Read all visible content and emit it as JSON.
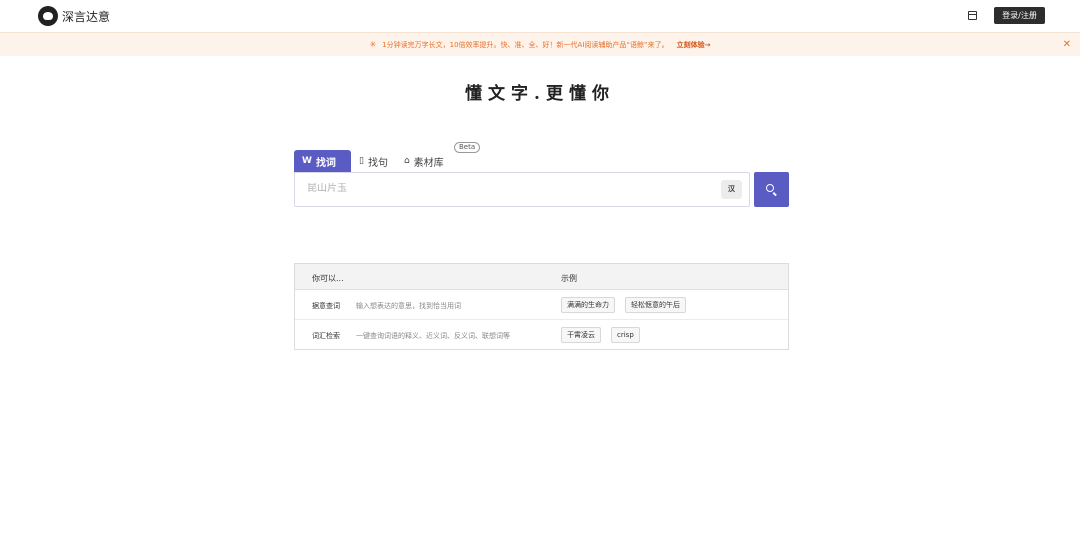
{
  "header": {
    "logo_text": "深言达意",
    "login_label": "登录/注册"
  },
  "banner": {
    "text": "1分钟读完万字长文，10倍效率提升。快、准、全、好！新一代AI阅读辅助产品“语鲸”来了。",
    "link": "立刻体验→",
    "close": "✕"
  },
  "hero": {
    "title": "懂文字.更懂你"
  },
  "tabs": [
    {
      "label": "找词",
      "icon": "W"
    },
    {
      "label": "找句",
      "icon": "▯"
    },
    {
      "label": "素材库",
      "icon": "⌂",
      "badge": "Beta"
    }
  ],
  "search": {
    "placeholder": "昆山片玉",
    "lang_toggle": "汉"
  },
  "guide": {
    "col_task": "你可以...",
    "col_example": "示例",
    "rows": [
      {
        "name": "据意查词",
        "desc": "输入想表达的意思，找到恰当用词",
        "examples": [
          "满满的生命力",
          "轻松惬意的午后"
        ]
      },
      {
        "name": "词汇检索",
        "desc": "一键查询词语的释义、近义词、反义词、联想词等",
        "examples": [
          "干霄凌云",
          "crisp"
        ]
      }
    ]
  }
}
